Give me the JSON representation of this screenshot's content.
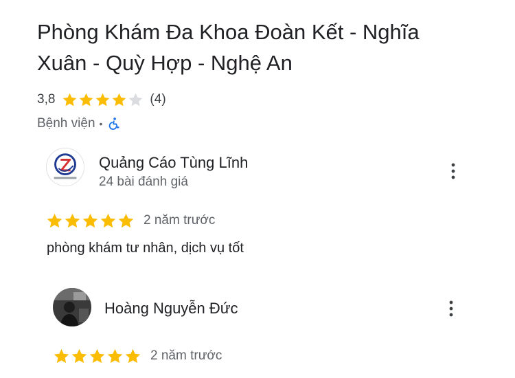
{
  "place": {
    "title": "Phòng Khám Đa Khoa Đoàn Kết - Nghĩa Xuân - Quỳ Hợp - Nghệ An",
    "rating": "3,8",
    "rating_stars": 3.8,
    "review_count": "(4)",
    "category": "Bệnh viện",
    "separator": "•",
    "accessibility_icon": "wheelchair-icon"
  },
  "colors": {
    "star_filled": "#fbbc04",
    "star_empty": "#dadce0",
    "accessibility": "#1a73e8"
  },
  "reviews": [
    {
      "reviewer": "Quảng Cáo Tùng Lĩnh",
      "meta": "24 bài đánh giá",
      "stars": 5,
      "date": "2 năm trước",
      "text": "phòng khám tư nhân, dịch vụ tốt",
      "menu_icon": "more-vert-icon"
    },
    {
      "reviewer": "Hoàng Nguyễn Đức",
      "stars": 5,
      "date": "2 năm trước",
      "menu_icon": "more-vert-icon"
    }
  ]
}
